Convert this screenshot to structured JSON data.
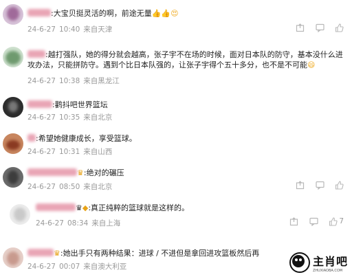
{
  "comments": [
    {
      "text": ":大宝贝挺灵活的啊，前途无量",
      "emoji": "👍👍😍",
      "date": "24-6-27",
      "time": "10:40",
      "location": "来自天津",
      "avatar_color": "#c9a0c8"
    },
    {
      "text": ":越打强队，她的得分就会越高，张子宇不在场的时候，面对日本队的防守，基本没什么进攻办法，只能拼防守。遇到个比日本队强的，让张子宇得个五十多分，也不是不可能",
      "emoji": "😄",
      "date": "24-6-27",
      "time": "10:38",
      "location": "来自黑龙江",
      "avatar_color": "#7aa37a"
    },
    {
      "text": ":鹳抖吧世界篮坛",
      "emoji": "",
      "date": "24-6-27",
      "time": "10:35",
      "location": "来自北京",
      "avatar_color": "#3a3a3a"
    },
    {
      "text": ":希望她健康成长，享受篮球。",
      "emoji": "",
      "date": "24-6-27",
      "time": "10:31",
      "location": "来自山西",
      "avatar_color": "#b4553a"
    },
    {
      "text": ":绝对的碾压",
      "emoji": "",
      "date": "24-6-27",
      "time": "08:50",
      "location": "来自北京",
      "avatar_color": "#5a5a5a"
    },
    {
      "text": ":真正纯粹的篮球就是这样的。",
      "emoji": "",
      "date": "24-6-27",
      "time": "08:34",
      "location": "来自上海",
      "avatar_color": "#e0e0e0",
      "likes": "7"
    },
    {
      "text": ":她出手只有两种结果：进球 / 不进但是拿回进攻篮板然后再",
      "emoji": "",
      "date": "24-6-27",
      "time": "00:07",
      "location": "来自澳大利亚",
      "avatar_color": "#d8b8b0"
    }
  ],
  "watermark": {
    "text": "主肖吧",
    "sub": "ZHUXIAOBA.COM"
  }
}
